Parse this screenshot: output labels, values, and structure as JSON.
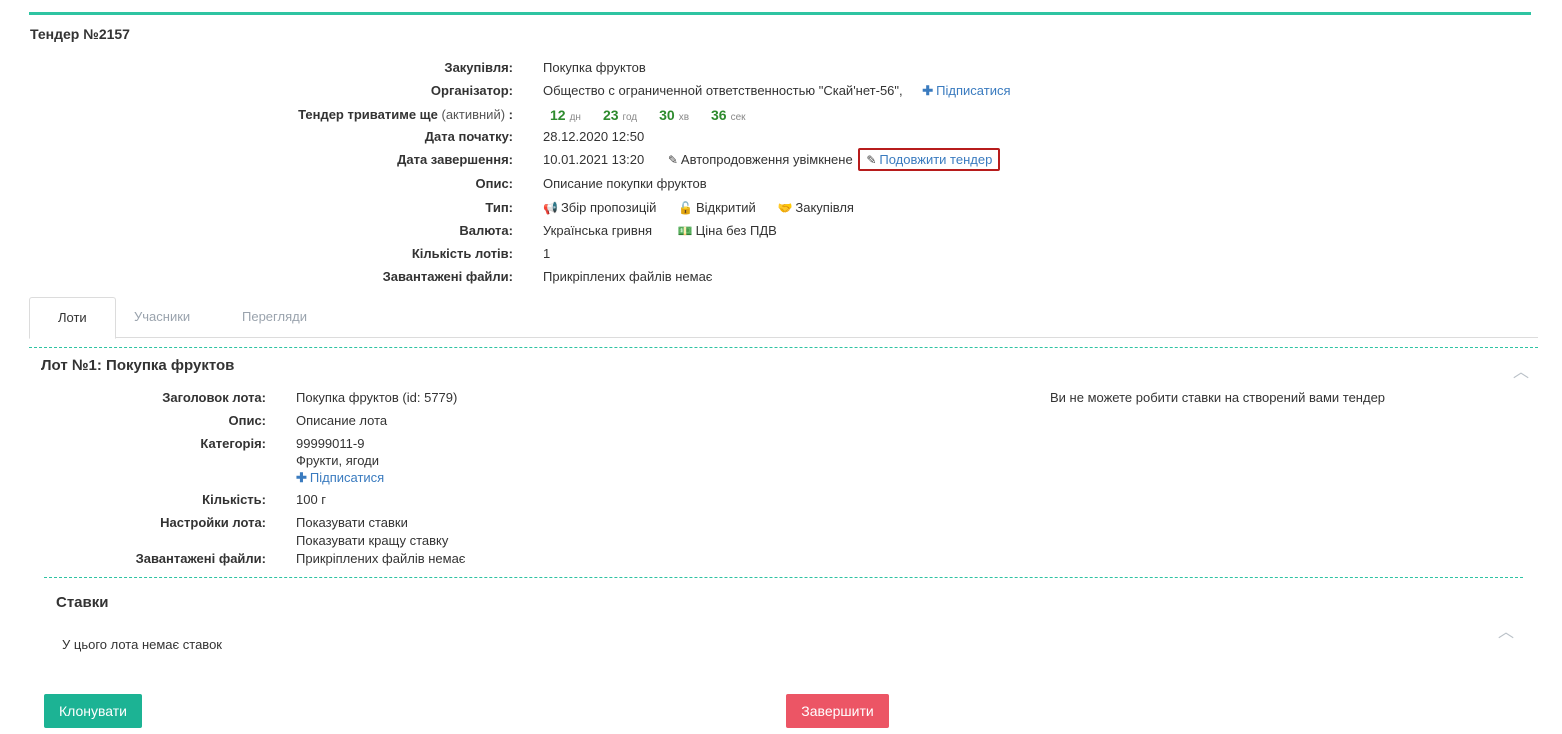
{
  "tender_title": "Тендер №2157",
  "info": {
    "procurement": {
      "label": "Закупівля:",
      "value": "Покупка фруктов"
    },
    "organizer": {
      "label": "Організатор:",
      "value": "Общество с ограниченной ответственностью \"Скай'нет-56\",",
      "subscribe": "Підписатися"
    },
    "duration": {
      "label": "Тендер триватиме ще",
      "status": "(активний)",
      "colon": ":",
      "days": "12",
      "days_unit": "дн",
      "hours": "23",
      "hours_unit": "год",
      "minutes": "30",
      "minutes_unit": "хв",
      "seconds": "36",
      "seconds_unit": "сек"
    },
    "start_date": {
      "label": "Дата початку:",
      "value": "28.12.2020 12:50"
    },
    "end_date": {
      "label": "Дата завершення:",
      "value": "10.01.2021 13:20",
      "auto_extend": "Автопродовження увімкнене",
      "extend_link": "Подовжити тендер"
    },
    "description": {
      "label": "Опис:",
      "value": "Описание покупки фруктов"
    },
    "type": {
      "label": "Тип:",
      "items": [
        "Збір пропозицій",
        "Відкритий",
        "Закупівля"
      ]
    },
    "currency": {
      "label": "Валюта:",
      "value": "Українська гривня",
      "vat": "Ціна без ПДВ"
    },
    "lot_count": {
      "label": "Кількість лотів:",
      "value": "1"
    },
    "files": {
      "label": "Завантажені файли:",
      "value": "Прикріплених файлів немає"
    }
  },
  "tabs": [
    "Лоти",
    "Учасники",
    "Перегляди"
  ],
  "lot": {
    "title": "Лот №1: Покупка фруктов",
    "heading": {
      "label": "Заголовок лота:",
      "value": "Покупка фруктов (id: 5779)"
    },
    "description": {
      "label": "Опис:",
      "value": "Описание лота"
    },
    "category": {
      "label": "Категорія:",
      "code": "99999011-9",
      "name": "Фрукти, ягоди",
      "subscribe": "Підписатися"
    },
    "quantity": {
      "label": "Кількість:",
      "value": "100 г"
    },
    "settings": {
      "label": "Настройки лота:",
      "values": [
        "Показувати ставки",
        "Показувати кращу ставку"
      ]
    },
    "files": {
      "label": "Завантажені файли:",
      "value": "Прикріплених файлів немає"
    },
    "no_bid_note": "Ви не можете робити ставки на створений вами тендер"
  },
  "bids": {
    "title": "Ставки",
    "empty": "У цього лота немає ставок"
  },
  "buttons": {
    "clone": "Клонувати",
    "finish": "Завершити"
  },
  "colors": {
    "accent": "#2ec4a2",
    "clone": "#1cb394",
    "finish": "#ec5565",
    "highlight": "#b71c1c",
    "link": "#3a7bbf",
    "countdown": "#2e8b2e"
  }
}
